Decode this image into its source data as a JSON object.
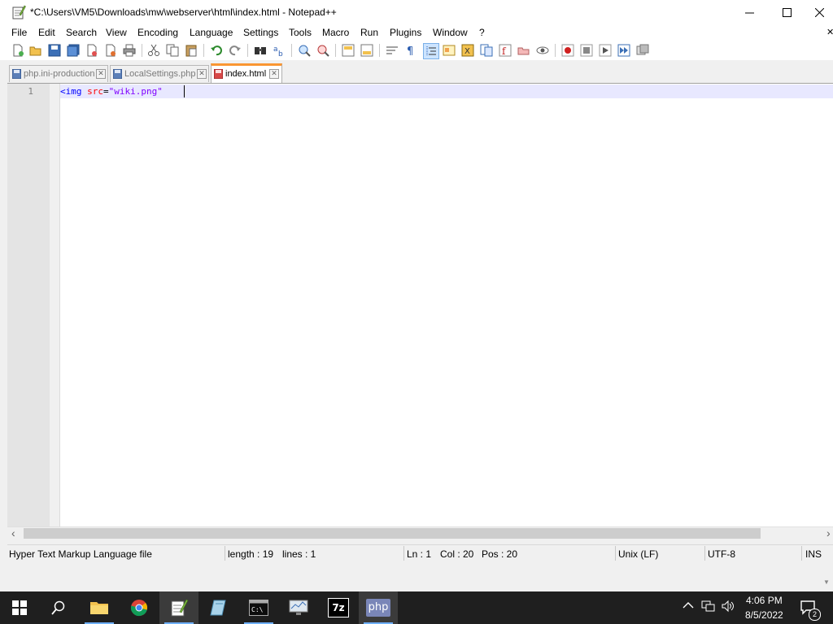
{
  "window": {
    "title": "*C:\\Users\\VM5\\Downloads\\mw\\webserver\\html\\index.html - Notepad++",
    "minimize_label": "—",
    "maximize_label": "☐",
    "close_label": "✕"
  },
  "menu": [
    "File",
    "Edit",
    "Search",
    "View",
    "Encoding",
    "Language",
    "Settings",
    "Tools",
    "Macro",
    "Run",
    "Plugins",
    "Window",
    "?"
  ],
  "menu_close": "✕",
  "tabs": [
    {
      "label": "php.ini-production",
      "state": "saved"
    },
    {
      "label": "LocalSettings.php",
      "state": "saved"
    },
    {
      "label": "index.html",
      "state": "modified",
      "active": true
    }
  ],
  "tab_close": "✕",
  "editor": {
    "line_number": "1",
    "code": {
      "open": "<img",
      "attr": "src",
      "eq": "=",
      "value": "\"wiki.png\""
    }
  },
  "scroll": {
    "left": "‹",
    "right": "›"
  },
  "status": {
    "file_type": "Hyper Text Markup Language file",
    "length": "length : 19",
    "lines": "lines : 1",
    "ln": "Ln : 1",
    "col": "Col : 20",
    "pos": "Pos : 20",
    "eol": "Unix (LF)",
    "encoding": "UTF-8",
    "mode": "INS"
  },
  "taskbar": {
    "apps": [
      {
        "name": "start",
        "icon": "windows-logo-icon"
      },
      {
        "name": "search",
        "icon": "search-icon"
      },
      {
        "name": "file-explorer",
        "icon": "folder-icon"
      },
      {
        "name": "chrome",
        "icon": "chrome-icon"
      },
      {
        "name": "notepad-plus-plus",
        "icon": "notepad-plus-plus-icon",
        "active": true
      },
      {
        "name": "app",
        "icon": "document-app-icon"
      },
      {
        "name": "command-prompt",
        "icon": "terminal-icon"
      },
      {
        "name": "task-manager",
        "icon": "monitor-icon"
      },
      {
        "name": "7zip",
        "icon": "7zip-icon",
        "label": "7z"
      },
      {
        "name": "php",
        "icon": "php-icon",
        "label": "php"
      }
    ],
    "time": "4:06 PM",
    "date": "8/5/2022",
    "notification_count": "2"
  },
  "colors": {
    "tab_active_accent": "#fa9632",
    "tag": "#0000ff",
    "attribute": "#ff0000",
    "string": "#8000ff",
    "current_line": "#e8e8ff",
    "taskbar": "#1f1f1f"
  }
}
